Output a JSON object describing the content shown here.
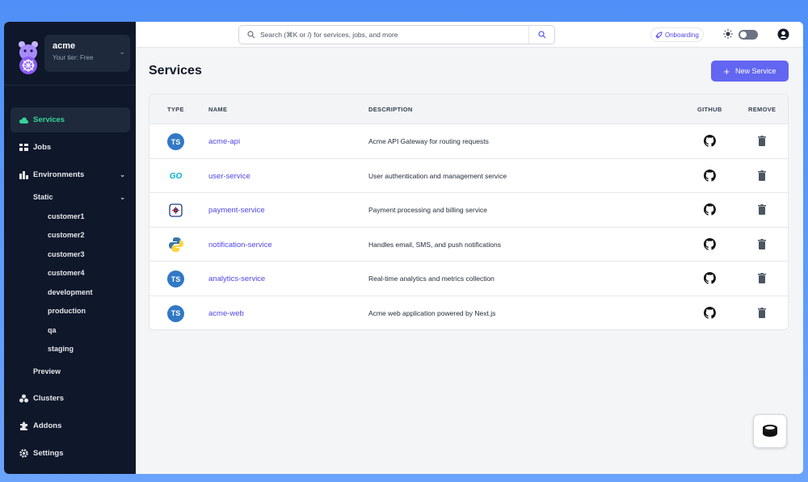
{
  "org": {
    "name": "acme",
    "tier": "Your tier: Free"
  },
  "nav": {
    "services": "Services",
    "jobs": "Jobs",
    "environments": "Environments",
    "static": "Static",
    "envs": [
      "customer1",
      "customer2",
      "customer3",
      "customer4",
      "development",
      "production",
      "qa",
      "staging"
    ],
    "preview": "Preview",
    "clusters": "Clusters",
    "addons": "Addons",
    "settings": "Settings"
  },
  "search": {
    "placeholder": "Search (⌘K or /) for services, jobs, and more"
  },
  "onboarding": "Onboarding",
  "page": {
    "title": "Services",
    "new_button": "New Service"
  },
  "table": {
    "headers": {
      "type": "TYPE",
      "name": "NAME",
      "description": "DESCRIPTION",
      "github": "GITHUB",
      "remove": "REMOVE"
    },
    "rows": [
      {
        "type": "typescript-icon",
        "type_label": "TS",
        "name": "acme-api",
        "description": "Acme API Gateway for routing requests"
      },
      {
        "type": "go-icon",
        "type_label": "GO",
        "name": "user-service",
        "description": "User authentication and management service"
      },
      {
        "type": "rust-icon",
        "type_label": "",
        "name": "payment-service",
        "description": "Payment processing and billing service"
      },
      {
        "type": "python-icon",
        "type_label": "",
        "name": "notification-service",
        "description": "Handles email, SMS, and push notifications"
      },
      {
        "type": "typescript-icon",
        "type_label": "TS",
        "name": "analytics-service",
        "description": "Real-time analytics and metrics collection"
      },
      {
        "type": "typescript-icon",
        "type_label": "TS",
        "name": "acme-web",
        "description": "Acme web application powered by Next.js"
      }
    ]
  },
  "colors": {
    "accent": "#6366f1",
    "active_nav": "#34d399",
    "sidebar": "#0f172a",
    "ts": "#3178c6",
    "go": "#00add8"
  }
}
